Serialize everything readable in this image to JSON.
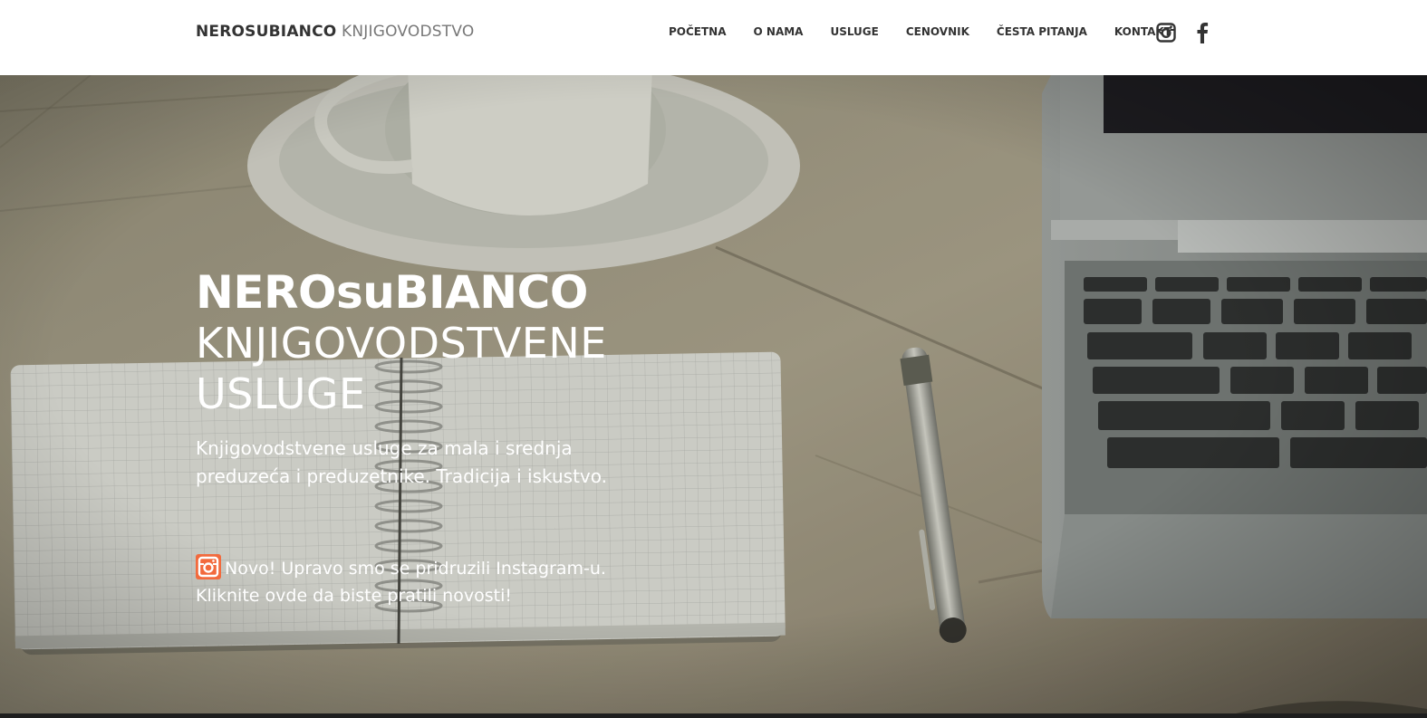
{
  "navbar": {
    "brand_strong": "NEROSUBIANCO",
    "brand_light": "KNJIGOVODSTVO",
    "links": [
      "POČETNA",
      "O NAMA",
      "USLUGE",
      "CENOVNIK",
      "ČESTA PITANJA",
      "KONTAKT"
    ],
    "social_icons": [
      "instagram-icon",
      "facebook-icon"
    ]
  },
  "hero": {
    "title_bold": "NEROsuBIANCO",
    "title_light_line1": "KNJIGOVODSTVENE",
    "title_light_line2": "USLUGE",
    "subtitle": "Knjigovodstvene usluge za mala i srednja preduzeća i preduzetnike. Tradicija i iskustvo.",
    "instagram_note": "Novo! Upravo smo se pridruzili Instagram-u. Kliknite ovde da biste pratili novosti!",
    "instagram_badge_color": "#f26a3d"
  },
  "colors": {
    "nav_text": "#333333",
    "brand_light": "#777777",
    "hero_text": "#ffffff"
  }
}
